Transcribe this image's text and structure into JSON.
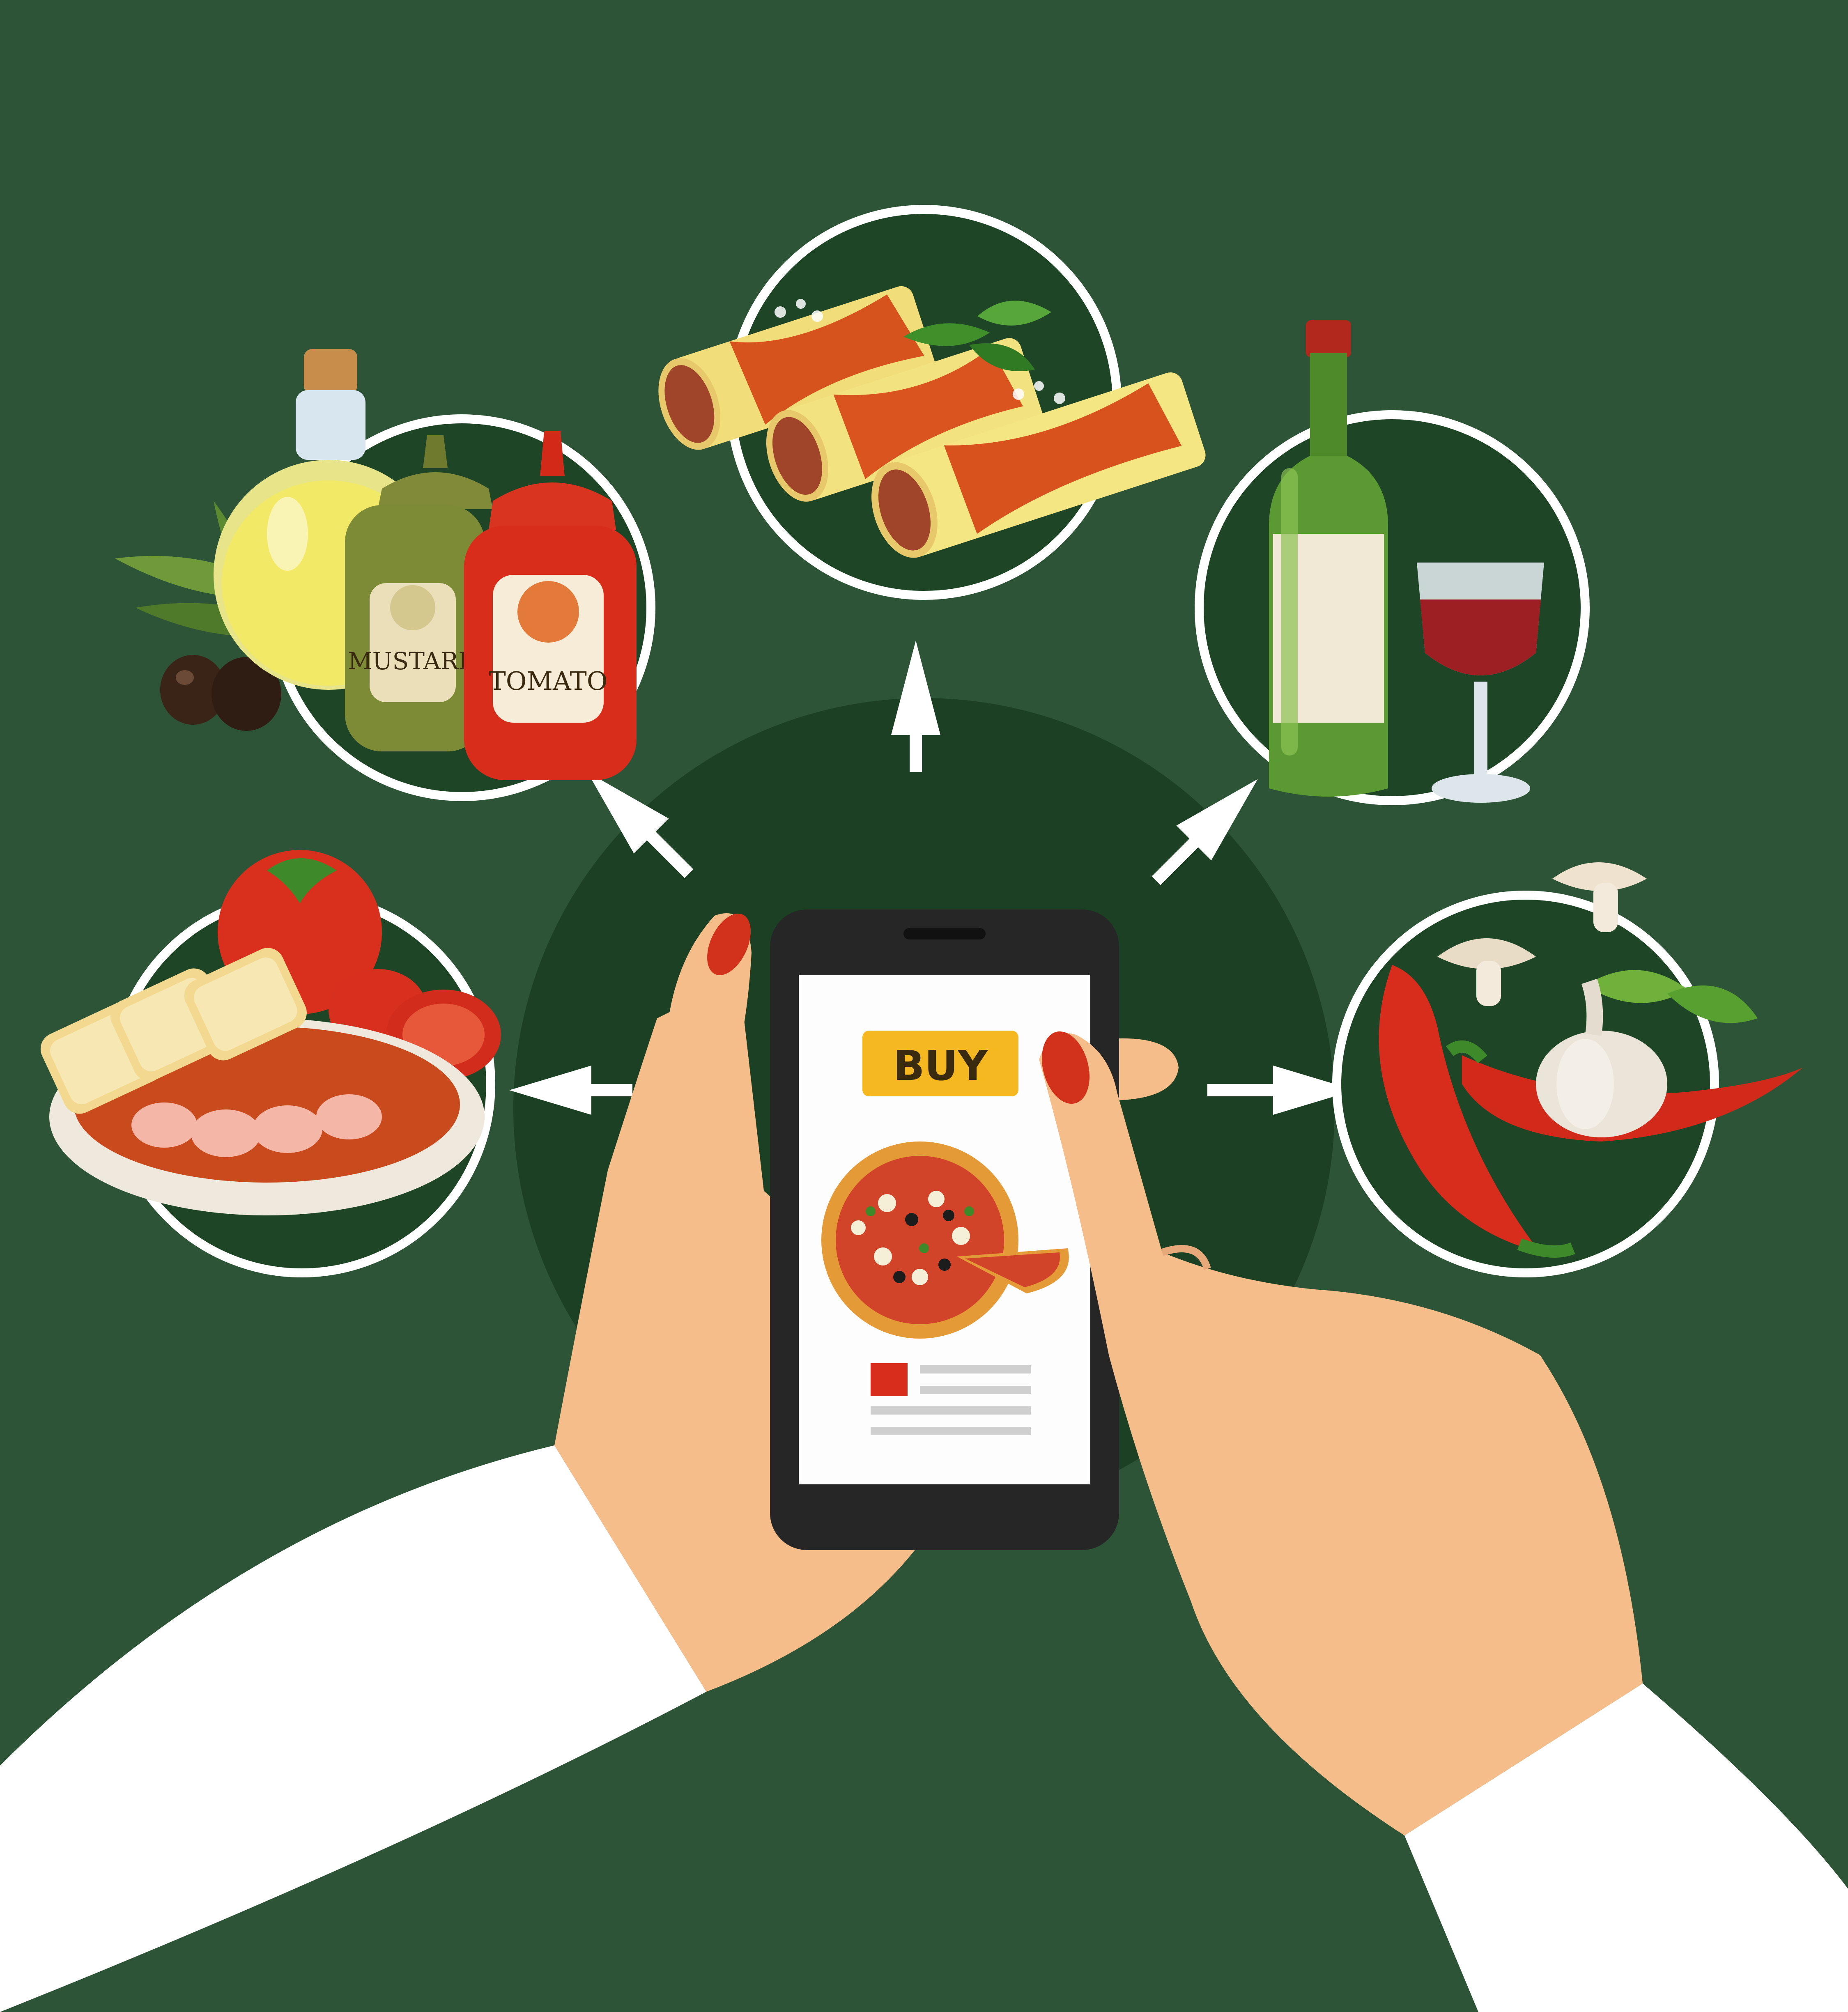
{
  "colors": {
    "background": "#2d5436",
    "circle_fill": "#1e4525",
    "circle_ring": "#ffffff",
    "center_glow": "#1b3d22",
    "phone_body": "#262626",
    "screen": "#fdfdfd",
    "buy_button": "#f5b820",
    "skin": "#f3bd8b",
    "nail": "#d2321c",
    "sleeve": "#ffffff"
  },
  "phone": {
    "buy_label": "BUY",
    "product_icon": "pizza-icon",
    "list_marker_icon": "red-square-icon"
  },
  "categories": [
    {
      "id": "sauces",
      "icon": "sauce-bottles-icon",
      "labels": [
        "MUSTARD",
        "TOMATO"
      ]
    },
    {
      "id": "pasta",
      "icon": "cannelloni-icon"
    },
    {
      "id": "wine",
      "icon": "wine-bottle-glass-icon"
    },
    {
      "id": "starters",
      "icon": "bruschetta-shrimp-plate-icon"
    },
    {
      "id": "vegetables",
      "icon": "pepper-garlic-mushroom-icon"
    }
  ]
}
